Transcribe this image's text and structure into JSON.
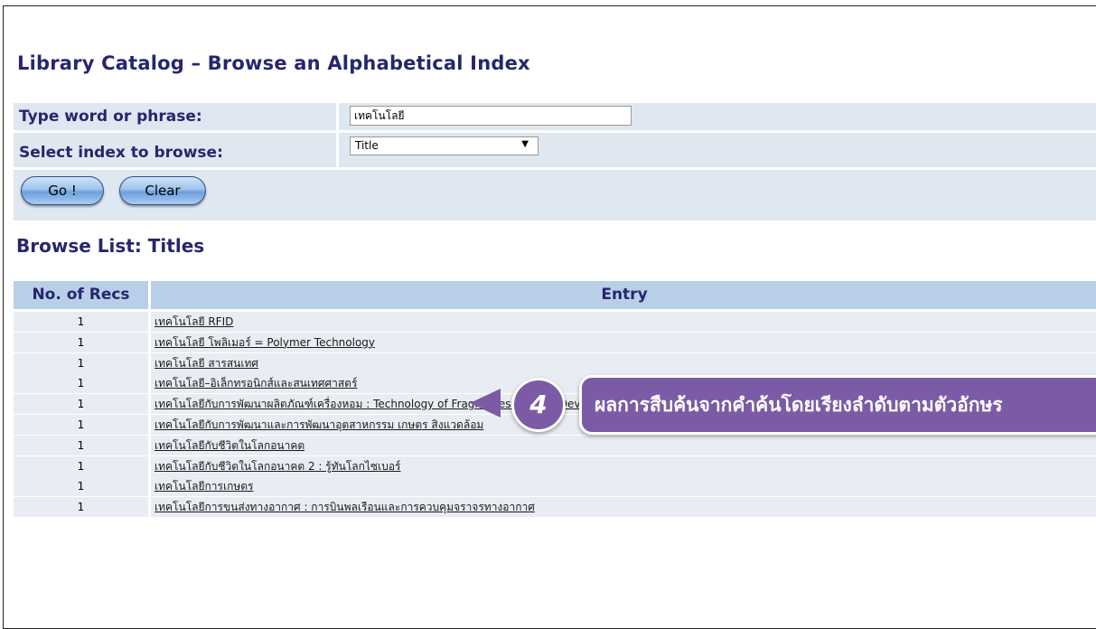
{
  "page": {
    "title": "Library Catalog – Browse an Alphabetical Index"
  },
  "search_form": {
    "word_label": "Type word or phrase:",
    "word_value": "เทคโนโลยี",
    "index_label": "Select index to browse:",
    "index_selected": "Title",
    "go_button": "Go !",
    "clear_button": "Clear"
  },
  "browse_list": {
    "title": "Browse List: Titles",
    "columns": [
      "No. of Recs",
      "Entry"
    ],
    "rows": [
      {
        "recs": "1",
        "entry": "เทคโนโลยี RFID"
      },
      {
        "recs": "1",
        "entry": "เทคโนโลยี โพลิเมอร์ = Polymer Technology"
      },
      {
        "recs": "1",
        "entry": "เทคโนโลยี สารสนเทศ"
      },
      {
        "recs": "1",
        "entry": "เทคโนโลยี–อิเล็กทรอนิกส์และสนเทศศาสตร์"
      },
      {
        "recs": "1",
        "entry": "เทคโนโลยีกับการพัฒนาผลิตภัณฑ์เครื่องหอม : Technology of Fragrances Product Development"
      },
      {
        "recs": "1",
        "entry": "เทคโนโลยีกับการพัฒนาและการพัฒนาอุตสาหกรรม เกษตร สิงแวดล้อม"
      },
      {
        "recs": "1",
        "entry": "เทคโนโลยีกับชีวิตในโลกอนาคต"
      },
      {
        "recs": "1",
        "entry": "เทคโนโลยีกับชีวิตในโลกอนาคต 2 : รู้ทันโลกไซเบอร์"
      },
      {
        "recs": "1",
        "entry": "เทคโนโลยีการเกษตร"
      },
      {
        "recs": "1",
        "entry": "เทคโนโลยีการขนส่งทางอากาศ : การบินพลเรือนและการควบคุมจราจรทางอากาศ"
      }
    ]
  },
  "callout": {
    "step_number": "4",
    "text": "ผลการสืบค้นจากคำค้นโดยเรียงลำดับตามตัวอักษร",
    "color": "#7b5ba6"
  },
  "colors": {
    "heading": "#26266e",
    "form_bg": "#dfe7f0",
    "header_bg": "#b9cfe8",
    "row_bg": "#e8edf3"
  }
}
